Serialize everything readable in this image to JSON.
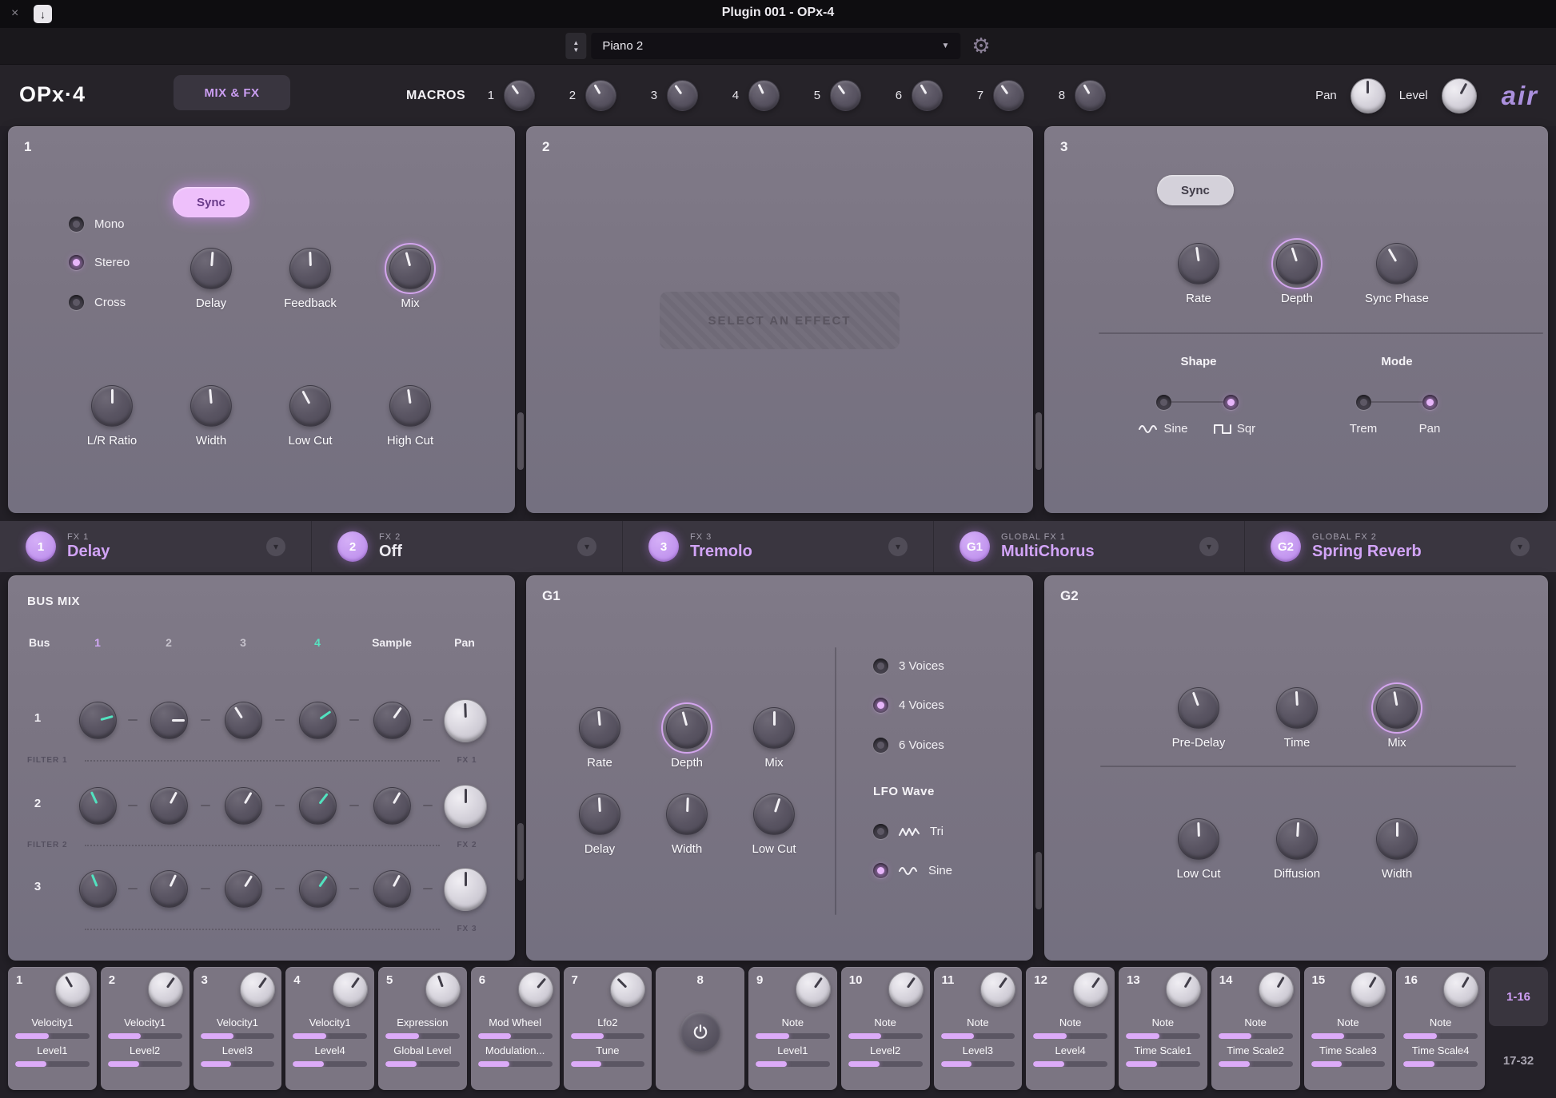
{
  "colors": {
    "accent": "#d2a4f7",
    "accent_deep": "#b888ea",
    "teal": "#52e2bf",
    "panel": "#7b7582",
    "strip": "#3a3640"
  },
  "icons": {
    "close": "×",
    "download": "↓",
    "stepper_up": "▲",
    "stepper_down": "▼",
    "dropdown_arrow": "▼",
    "gear": "⚙",
    "chevron_down": "▾"
  },
  "titlebar": {
    "title": "Plugin 001 - OPx-4"
  },
  "preset_bar": {
    "preset": "Piano 2"
  },
  "header": {
    "logo": "OPx·4",
    "page_button": "MIX & FX",
    "macros_label": "MACROS",
    "macros": [
      {
        "num": "1",
        "angle": -35
      },
      {
        "num": "2",
        "angle": -30
      },
      {
        "num": "3",
        "angle": -35
      },
      {
        "num": "4",
        "angle": -25
      },
      {
        "num": "5",
        "angle": -35
      },
      {
        "num": "6",
        "angle": -30
      },
      {
        "num": "7",
        "angle": -35
      },
      {
        "num": "8",
        "angle": -30
      }
    ],
    "pan": {
      "label": "Pan",
      "angle": 0
    },
    "level": {
      "label": "Level",
      "angle": 28
    },
    "brand": "air"
  },
  "panel1": {
    "number": "1",
    "sync": "Sync",
    "radios": [
      {
        "label": "Mono"
      },
      {
        "label": "Stereo"
      },
      {
        "label": "Cross"
      }
    ],
    "row1": [
      {
        "label": "Delay",
        "angle": 4
      },
      {
        "label": "Feedback",
        "angle": -2
      },
      {
        "label": "Mix",
        "angle": -15
      }
    ],
    "row2": [
      {
        "label": "L/R Ratio",
        "angle": 0
      },
      {
        "label": "Width",
        "angle": -5
      },
      {
        "label": "Low Cut",
        "angle": -28
      },
      {
        "label": "High Cut",
        "angle": -8
      }
    ]
  },
  "panel2": {
    "number": "2",
    "placeholder": "SELECT AN EFFECT"
  },
  "panel3": {
    "number": "3",
    "sync": "Sync",
    "row1": [
      {
        "label": "Rate",
        "angle": -8
      },
      {
        "label": "Depth",
        "angle": -18
      },
      {
        "label": "Sync Phase",
        "angle": -30
      }
    ],
    "shape_title": "Shape",
    "mode_title": "Mode",
    "shape_options": [
      {
        "label": "Sine"
      },
      {
        "label": "Sqr"
      }
    ],
    "mode_options": [
      {
        "label": "Trem"
      },
      {
        "label": "Pan"
      }
    ]
  },
  "fx_strip": [
    {
      "badge": "1",
      "slot": "FX 1",
      "name": "Delay"
    },
    {
      "badge": "2",
      "slot": "FX 2",
      "name": "Off"
    },
    {
      "badge": "3",
      "slot": "FX 3",
      "name": "Tremolo"
    },
    {
      "badge": "G1",
      "slot": "Global FX 1",
      "name": "MultiChorus"
    },
    {
      "badge": "G2",
      "slot": "Global FX 2",
      "name": "Spring Reverb"
    }
  ],
  "bus_mix": {
    "title": "BUS MIX",
    "col_headers": [
      "Bus",
      "1",
      "2",
      "3",
      "4",
      "Sample",
      "Pan"
    ],
    "rows": [
      {
        "number": "1",
        "left_label": "FILTER 1",
        "right_label": "FX 1",
        "angles": [
          75,
          90,
          -32,
          55,
          35,
          -2
        ]
      },
      {
        "number": "2",
        "left_label": "FILTER 2",
        "right_label": "FX 2",
        "angles": [
          -25,
          28,
          30,
          38,
          30,
          0
        ]
      },
      {
        "number": "3",
        "left_label": "",
        "right_label": "FX 3",
        "angles": [
          -22,
          25,
          32,
          35,
          28,
          0
        ]
      }
    ]
  },
  "g1": {
    "number": "G1",
    "row1": [
      {
        "label": "Rate",
        "angle": -5
      },
      {
        "label": "Depth",
        "angle": -15
      },
      {
        "label": "Mix",
        "angle": 0
      }
    ],
    "row2": [
      {
        "label": "Delay",
        "angle": -3
      },
      {
        "label": "Width",
        "angle": 2
      },
      {
        "label": "Low Cut",
        "angle": 18
      }
    ],
    "voices": [
      {
        "label": "3 Voices"
      },
      {
        "label": "4 Voices"
      },
      {
        "label": "6 Voices"
      }
    ],
    "lfo_title": "LFO Wave",
    "lfo_options": [
      {
        "label": "Tri"
      },
      {
        "label": "Sine"
      }
    ]
  },
  "g2": {
    "number": "G2",
    "row1": [
      {
        "label": "Pre-Delay",
        "angle": -20
      },
      {
        "label": "Time",
        "angle": -3
      },
      {
        "label": "Mix",
        "angle": -10
      }
    ],
    "row2": [
      {
        "label": "Low Cut",
        "angle": -2
      },
      {
        "label": "Diffusion",
        "angle": 3
      },
      {
        "label": "Width",
        "angle": 0
      }
    ]
  },
  "cells": [
    {
      "number": "1",
      "name": "Velocity1",
      "param": "Level1",
      "angle": -30,
      "fill1": 45,
      "fill2": 42
    },
    {
      "number": "2",
      "name": "Velocity1",
      "param": "Level2",
      "angle": 35,
      "fill1": 45,
      "fill2": 42
    },
    {
      "number": "3",
      "name": "Velocity1",
      "param": "Level3",
      "angle": 35,
      "fill1": 45,
      "fill2": 42
    },
    {
      "number": "4",
      "name": "Velocity1",
      "param": "Level4",
      "angle": 35,
      "fill1": 45,
      "fill2": 42
    },
    {
      "number": "5",
      "name": "Expression",
      "param": "Global Level",
      "angle": -20,
      "fill1": 45,
      "fill2": 42
    },
    {
      "number": "6",
      "name": "Mod Wheel",
      "param": "Modulation...",
      "angle": 40,
      "fill1": 45,
      "fill2": 42
    },
    {
      "number": "7",
      "name": "Lfo2",
      "param": "Tune",
      "angle": -45,
      "fill1": 45,
      "fill2": 42
    },
    {
      "number": "8"
    },
    {
      "number": "9",
      "name": "Note",
      "param": "Level1",
      "angle": 35,
      "fill1": 45,
      "fill2": 42
    },
    {
      "number": "10",
      "name": "Note",
      "param": "Level2",
      "angle": 35,
      "fill1": 45,
      "fill2": 42
    },
    {
      "number": "11",
      "name": "Note",
      "param": "Level3",
      "angle": 35,
      "fill1": 45,
      "fill2": 42
    },
    {
      "number": "12",
      "name": "Note",
      "param": "Level4",
      "angle": 35,
      "fill1": 45,
      "fill2": 42
    },
    {
      "number": "13",
      "name": "Note",
      "param": "Time Scale1",
      "angle": 30,
      "fill1": 45,
      "fill2": 42
    },
    {
      "number": "14",
      "name": "Note",
      "param": "Time Scale2",
      "angle": 30,
      "fill1": 45,
      "fill2": 42
    },
    {
      "number": "15",
      "name": "Note",
      "param": "Time Scale3",
      "angle": 30,
      "fill1": 45,
      "fill2": 42
    },
    {
      "number": "16",
      "name": "Note",
      "param": "Time Scale4",
      "angle": 30,
      "fill1": 45,
      "fill2": 42
    }
  ],
  "pager": {
    "top": "1-16",
    "bottom": "17-32"
  }
}
